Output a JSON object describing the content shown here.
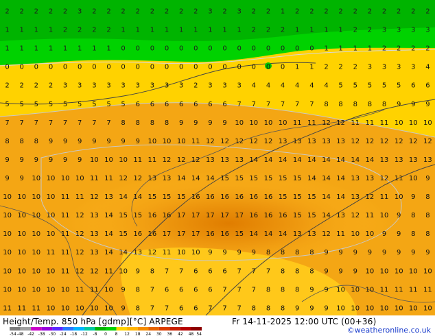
{
  "map": {
    "background_colors": {
      "green_top": "#00b400",
      "green_light": "#00d200",
      "yellow": "#ffd200",
      "yellow_light": "#ffe11e",
      "orange_light": "#f5aa14",
      "orange": "#e68c0a",
      "orange_dark": "#dc7800"
    },
    "grid_values": [
      "2 2 2 2 2 3 2 2 2 2 2 2 2 2 3 2 3 2 2 1 2 2 2 2 2 2 2 2 2 2",
      "1 1 1 1 2 2 2 2 1 1 1 1 1 1 1 1 1 2 2 2 1 1 1 1 2 2 3 3 3 3",
      "1 1 1 1 1 1 1 1 0 0 0 0 0 0 0 0 0 0 0 0 0 0 1 1 1 1 2 2 2 2",
      "0 0 0 0 0 0 0 0 0 0 0 0 0 0 0 0 0 0 0 0 1 1 2 2 2 3 3 3 3 4",
      "2 2 2 2 3 3 3 3 3 3 3 3 3 2 3 3 3 4 4 4 4 4 4 5 5 5 5 5 6 6",
      "5 5 5 5 5 5 5 5 5 6 6 6 6 6 6 6 7 7 7 7 7 7 8 8 8 8 8 9 9 9",
      "7 7 7 7 7 7 7 7 8 8 8 8 9 9 9 9 10 10 10 10 11 11 12 12 11 11 11 10 10 10",
      "8 8 8 9 9 9 9 9 9 9 10 10 10 11 12 12 12 12 12 13 13 13 13 13 12 12 12 12 12 12",
      "9 9 9 9 9 9 10 10 10 11 11 12 12 12 13 13 13 14 14 14 14 14 14 14 14 14 13 13 13 13",
      "9 9 10 10 10 10 11 11 12 12 13 13 14 14 14 15 15 15 15 15 15 14 14 14 13 13 12 11 10 9",
      "10 10 10 10 11 11 12 13 14 14 15 15 15 16 16 16 16 16 16 15 15 15 14 14 13 12 11 10 9 8",
      "10 10 10 10 11 12 13 14 15 15 16 16 17 17 17 17 17 16 16 16 15 15 14 13 12 11 10 9 8 8",
      "10 10 10 10 11 12 13 14 15 16 16 17 17 17 16 16 15 14 14 14 13 13 12 11 10 10 9 9 8 8",
      "10 10 10 11 11 12 13 14 14 13 12 11 10 10 9 9 9 9 8 8 8 8 9 9 9 9 9 9 9 9",
      "10 10 10 10 11 12 12 11 10 9 8 7 7 6 6 6 7 7 7 8 8 8 9 9 9 10 10 10 10 10",
      "10 10 10 10 10 11 11 10 9 8 7 6 6 6 6 7 7 7 8 8 8 9 9 10 10 10 11 11 11 11",
      "11 11 11 10 10 10 10 10 9 8 7 7 6 6 7 7 7 8 8 8 9 9 9 10 10 10 10 10 10 10"
    ]
  },
  "footer": {
    "title": "Height/Temp. 850 hPa [gdmp][°C] ARPEGE",
    "datetime": "Fr 14-11-2025 12:00 UTC (00+36)",
    "credit": "©weatheronline.co.uk",
    "scale_labels": [
      "-54",
      "-48",
      "-42",
      "-38",
      "-30",
      "-24",
      "-18",
      "-12",
      "-8",
      "0",
      "8",
      "12",
      "18",
      "24",
      "30",
      "36",
      "42",
      "48",
      "54"
    ],
    "scale_colors": [
      "#7d7d7d",
      "#a0a0a0",
      "#c800c8",
      "#9600dc",
      "#5a28ff",
      "#2878ff",
      "#00b4ff",
      "#00c8a0",
      "#00b400",
      "#00d200",
      "#ffd200",
      "#ffb400",
      "#f58c00",
      "#e66400",
      "#dc3c00",
      "#c81e00",
      "#b40000",
      "#8c0000"
    ]
  }
}
